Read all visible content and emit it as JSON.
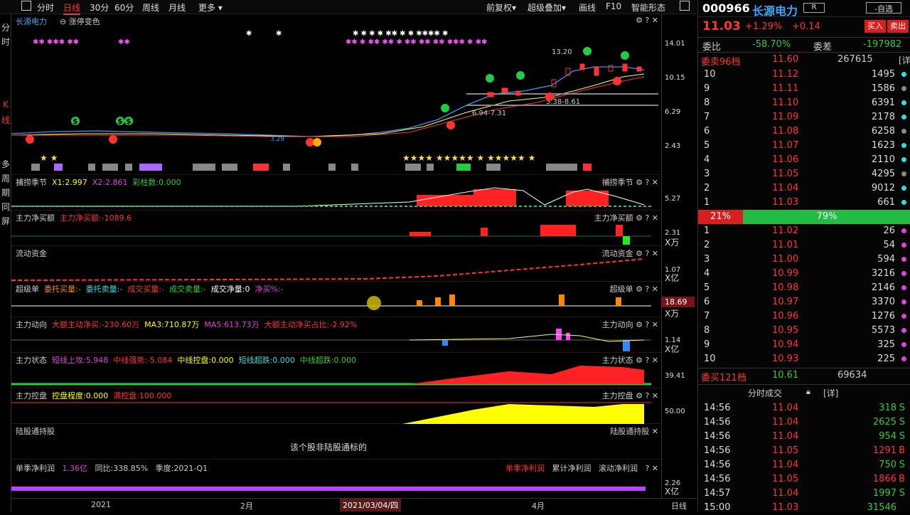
{
  "toolbar": {
    "periods": [
      "分时",
      "日线",
      "30分",
      "60分",
      "周线",
      "月线",
      "更多"
    ],
    "active": "日线",
    "right": [
      "前复权",
      "超级叠加",
      "画线",
      "F10",
      "智能形态"
    ]
  },
  "left_sidebar": [
    "分",
    "时",
    "K",
    "线",
    "多",
    "周",
    "期",
    "同",
    "屏"
  ],
  "kline": {
    "name": "长源电力",
    "toggle": "涨停变色",
    "annotations": [
      "13.20",
      "6.94-7.31",
      "3.38-8.61",
      "3.29"
    ],
    "axis": [
      "14.01",
      "10.15",
      "6.29",
      "2.43"
    ]
  },
  "panels": [
    {
      "title": "捕捞季节",
      "items": [
        {
          "t": "X1:2.997",
          "c": "yellow"
        },
        {
          "t": "X2:2.861",
          "c": "purple"
        },
        {
          "t": "彩柱数:0.000",
          "c": "green"
        }
      ],
      "right": "捕捞季节",
      "axis": "5.27"
    },
    {
      "title": "主力净买额",
      "items": [
        {
          "t": "主力净买额:-1089.6",
          "c": "red"
        }
      ],
      "right": "主力净买额",
      "axis": "2.31",
      "unit": "X万"
    },
    {
      "title": "流动资金",
      "items": [],
      "right": "流动资金",
      "axis": "1.07",
      "unit": "X亿"
    },
    {
      "title": "超级单",
      "items": [
        {
          "t": "委托买量:-",
          "c": "orange"
        },
        {
          "t": "委托卖量:-",
          "c": "cyan"
        },
        {
          "t": "成交买量:-",
          "c": "red"
        },
        {
          "t": "成交卖量:-",
          "c": "green"
        },
        {
          "t": "成交净量:0",
          "c": "white"
        },
        {
          "t": "净买%:-",
          "c": "purple"
        }
      ],
      "right": "超级单",
      "axis": "18.69",
      "unit": "X万"
    },
    {
      "title": "主力动向",
      "items": [
        {
          "t": "大额主动净买:-230.60万",
          "c": "red"
        },
        {
          "t": "MA3:710.87万",
          "c": "yellow"
        },
        {
          "t": "MA5:613.73万",
          "c": "purple"
        },
        {
          "t": "大额主动净买占比:-2.92%",
          "c": "red"
        }
      ],
      "right": "主力动向",
      "axis": "1.14",
      "unit": "X亿"
    },
    {
      "title": "主力状态",
      "items": [
        {
          "t": "短线上攻:5.948",
          "c": "purple"
        },
        {
          "t": "中线强势:-5.084",
          "c": "red"
        },
        {
          "t": "中线控盘:0.000",
          "c": "yellow"
        },
        {
          "t": "短线超跌:0.000",
          "c": "cyan"
        },
        {
          "t": "中线超跌:0.000",
          "c": "green"
        }
      ],
      "right": "主力状态",
      "axis": "39.41"
    },
    {
      "title": "主力控盘",
      "items": [
        {
          "t": "控盘程度:0.000",
          "c": "yellow"
        },
        {
          "t": "满控盘:100.000",
          "c": "red"
        }
      ],
      "right": "主力控盘",
      "axis": "50.00"
    }
  ],
  "hsgt": {
    "title": "陆股通持股",
    "right": "陆股通持股",
    "message": "该个股非陆股通标的"
  },
  "profit": {
    "title": "单季净利润",
    "value": "1.36亿",
    "yoy": "同比:338.85%",
    "season": "季度:2021-Q1",
    "tabs": [
      "单季净利润",
      "累计净利润",
      "滚动净利润"
    ],
    "axis": "2.26",
    "unit": "X亿"
  },
  "dates": {
    "labels": [
      "2021",
      "2月",
      "2021/03/04/四",
      "4月"
    ],
    "period": "日线"
  },
  "quote": {
    "code": "000966",
    "name": "长源电力",
    "badge": "R",
    "watch": "-自选",
    "price": "11.03",
    "pct": "+1.29%",
    "chg": "+0.14",
    "buy": "买入",
    "sell": "卖出",
    "weibi_label": "委比",
    "weibi": "-58.70%",
    "weicha_label": "委差",
    "weicha": "-197982",
    "sell_header": {
      "label": "委卖96档",
      "price": "11.60",
      "vol": "267615",
      "detail": "[详"
    },
    "asks": [
      [
        "10",
        "11.12",
        "1495"
      ],
      [
        "9",
        "11.11",
        "1586"
      ],
      [
        "8",
        "11.10",
        "6391"
      ],
      [
        "7",
        "11.09",
        "2178"
      ],
      [
        "6",
        "11.08",
        "6258"
      ],
      [
        "5",
        "11.07",
        "1623"
      ],
      [
        "4",
        "11.06",
        "2110"
      ],
      [
        "3",
        "11.05",
        "4295"
      ],
      [
        "2",
        "11.04",
        "9012"
      ],
      [
        "1",
        "11.03",
        "661"
      ]
    ],
    "ratio_left": "21%",
    "ratio_right": "79%",
    "bids": [
      [
        "1",
        "11.02",
        "26"
      ],
      [
        "2",
        "11.01",
        "54"
      ],
      [
        "3",
        "11.00",
        "594"
      ],
      [
        "4",
        "10.99",
        "3216"
      ],
      [
        "5",
        "10.98",
        "2146"
      ],
      [
        "6",
        "10.97",
        "3370"
      ],
      [
        "7",
        "10.96",
        "1276"
      ],
      [
        "8",
        "10.95",
        "5573"
      ],
      [
        "9",
        "10.94",
        "325"
      ],
      [
        "10",
        "10.93",
        "225"
      ]
    ],
    "buy_header": {
      "label": "委买121档",
      "price": "10.61",
      "vol": "69634"
    },
    "ticks_title": "分时成交",
    "ticks_detail": "[详]",
    "ticks": [
      [
        "14:56",
        "11.04",
        "318",
        "S"
      ],
      [
        "14:56",
        "11.04",
        "2625",
        "S"
      ],
      [
        "14:56",
        "11.04",
        "954",
        "S"
      ],
      [
        "14:56",
        "11.05",
        "1291",
        "B"
      ],
      [
        "14:56",
        "11.04",
        "750",
        "S"
      ],
      [
        "14:56",
        "11.05",
        "1866",
        "B"
      ],
      [
        "14:57",
        "11.04",
        "1997",
        "S"
      ],
      [
        "15:00",
        "11.03",
        "31546",
        ""
      ]
    ]
  },
  "cursor_value": "18.69",
  "colors": {
    "up": "#ff3333",
    "down": "#33cc33",
    "bg": "#000000",
    "accent": "#ffff00"
  }
}
